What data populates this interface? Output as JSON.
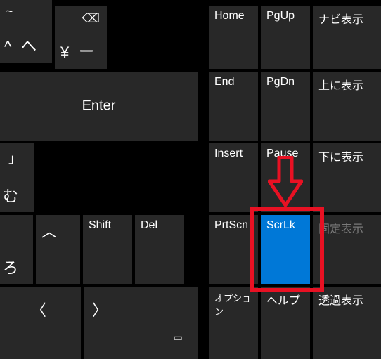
{
  "keys": {
    "tilde": {
      "top": "~",
      "bl1": "^",
      "bl2": "へ"
    },
    "yen": {
      "bksp": "⌫",
      "bl1": "¥",
      "bl2": "ー"
    },
    "enter": {
      "label": "Enter"
    },
    "mu": {
      "top": "」",
      "bl": "む"
    },
    "ro": {
      "bl": "ろ"
    },
    "shiftUp": {
      "glyph": "︿"
    },
    "shift": {
      "label": "Shift"
    },
    "del": {
      "label": "Del"
    },
    "shiftLeft": {
      "glyph": "〈"
    },
    "shiftRight": {
      "glyph": "〉"
    },
    "menu": {
      "glyph": "▭"
    },
    "home": {
      "label": "Home"
    },
    "pgup": {
      "label": "PgUp"
    },
    "navshow": {
      "label": "ナビ表示"
    },
    "end": {
      "label": "End"
    },
    "pgdn": {
      "label": "PgDn"
    },
    "upshow": {
      "label": "上に表示"
    },
    "insert": {
      "label": "Insert"
    },
    "pause": {
      "label": "Pause"
    },
    "downshow": {
      "label": "下に表示"
    },
    "prtscn": {
      "label": "PrtScn"
    },
    "scrlk": {
      "label": "ScrLk"
    },
    "fixshow": {
      "label": "固定表示"
    },
    "option": {
      "label": "オプション"
    },
    "help": {
      "label": "ヘルプ"
    },
    "transshow": {
      "label": "透過表示"
    }
  }
}
